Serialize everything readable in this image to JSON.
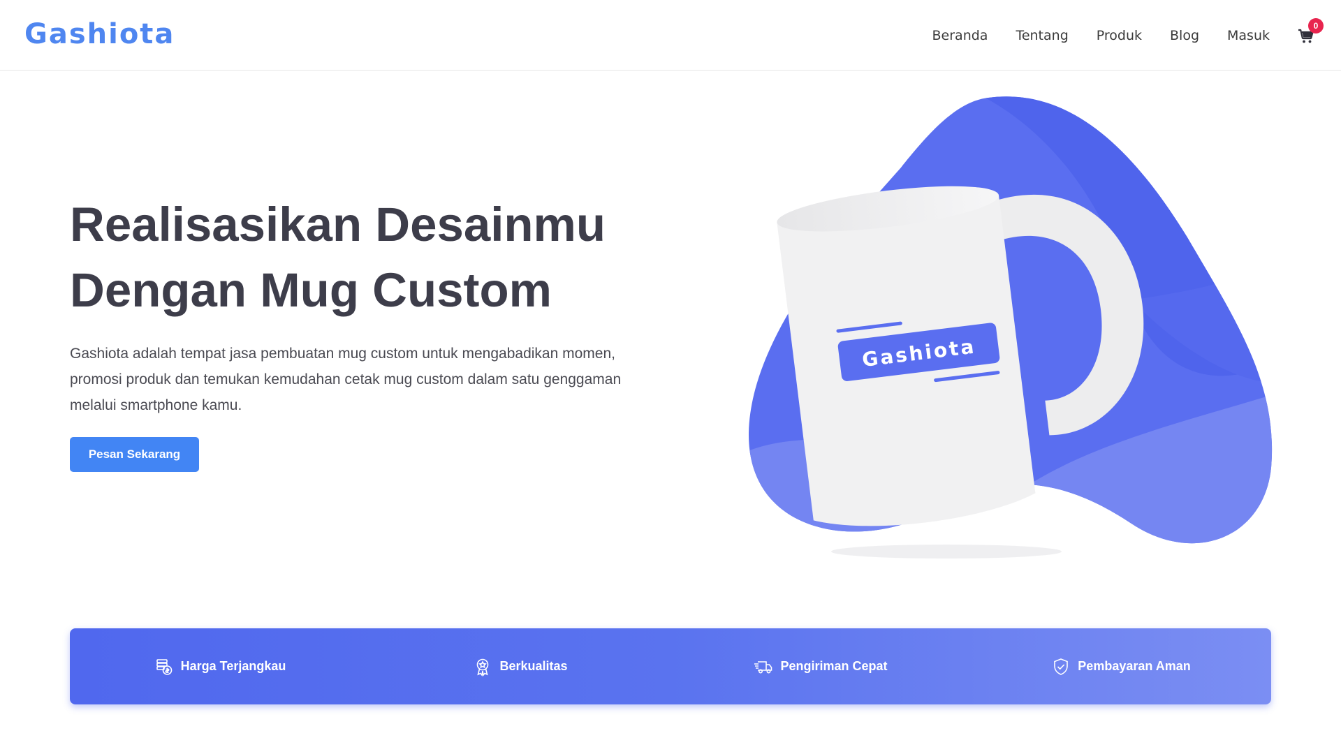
{
  "header": {
    "logo": "Gashiota",
    "nav": [
      "Beranda",
      "Tentang",
      "Produk",
      "Blog",
      "Masuk"
    ],
    "cart_count": "0",
    "cart_icon": "shopping-cart-icon"
  },
  "hero": {
    "title_line1": "Realisasikan Desainmu",
    "title_line2": "Dengan Mug Custom",
    "description": "Gashiota adalah tempat jasa pembuatan mug custom untuk mengabadikan momen, promosi produk dan temukan kemudahan cetak mug custom dalam satu genggaman melalui smartphone kamu.",
    "cta_label": "Pesan Sekarang",
    "mug_label": "Gashiota"
  },
  "features": [
    {
      "icon": "coins-icon",
      "label": "Harga Terjangkau"
    },
    {
      "icon": "award-badge-icon",
      "label": "Berkualitas"
    },
    {
      "icon": "delivery-truck-icon",
      "label": "Pengiriman Cepat"
    },
    {
      "icon": "shield-check-icon",
      "label": "Pembayaran Aman"
    }
  ],
  "colors": {
    "brand": "#4f86f0",
    "cta": "#4285f4",
    "blob": "#5068ee",
    "badge": "#e8244e"
  }
}
